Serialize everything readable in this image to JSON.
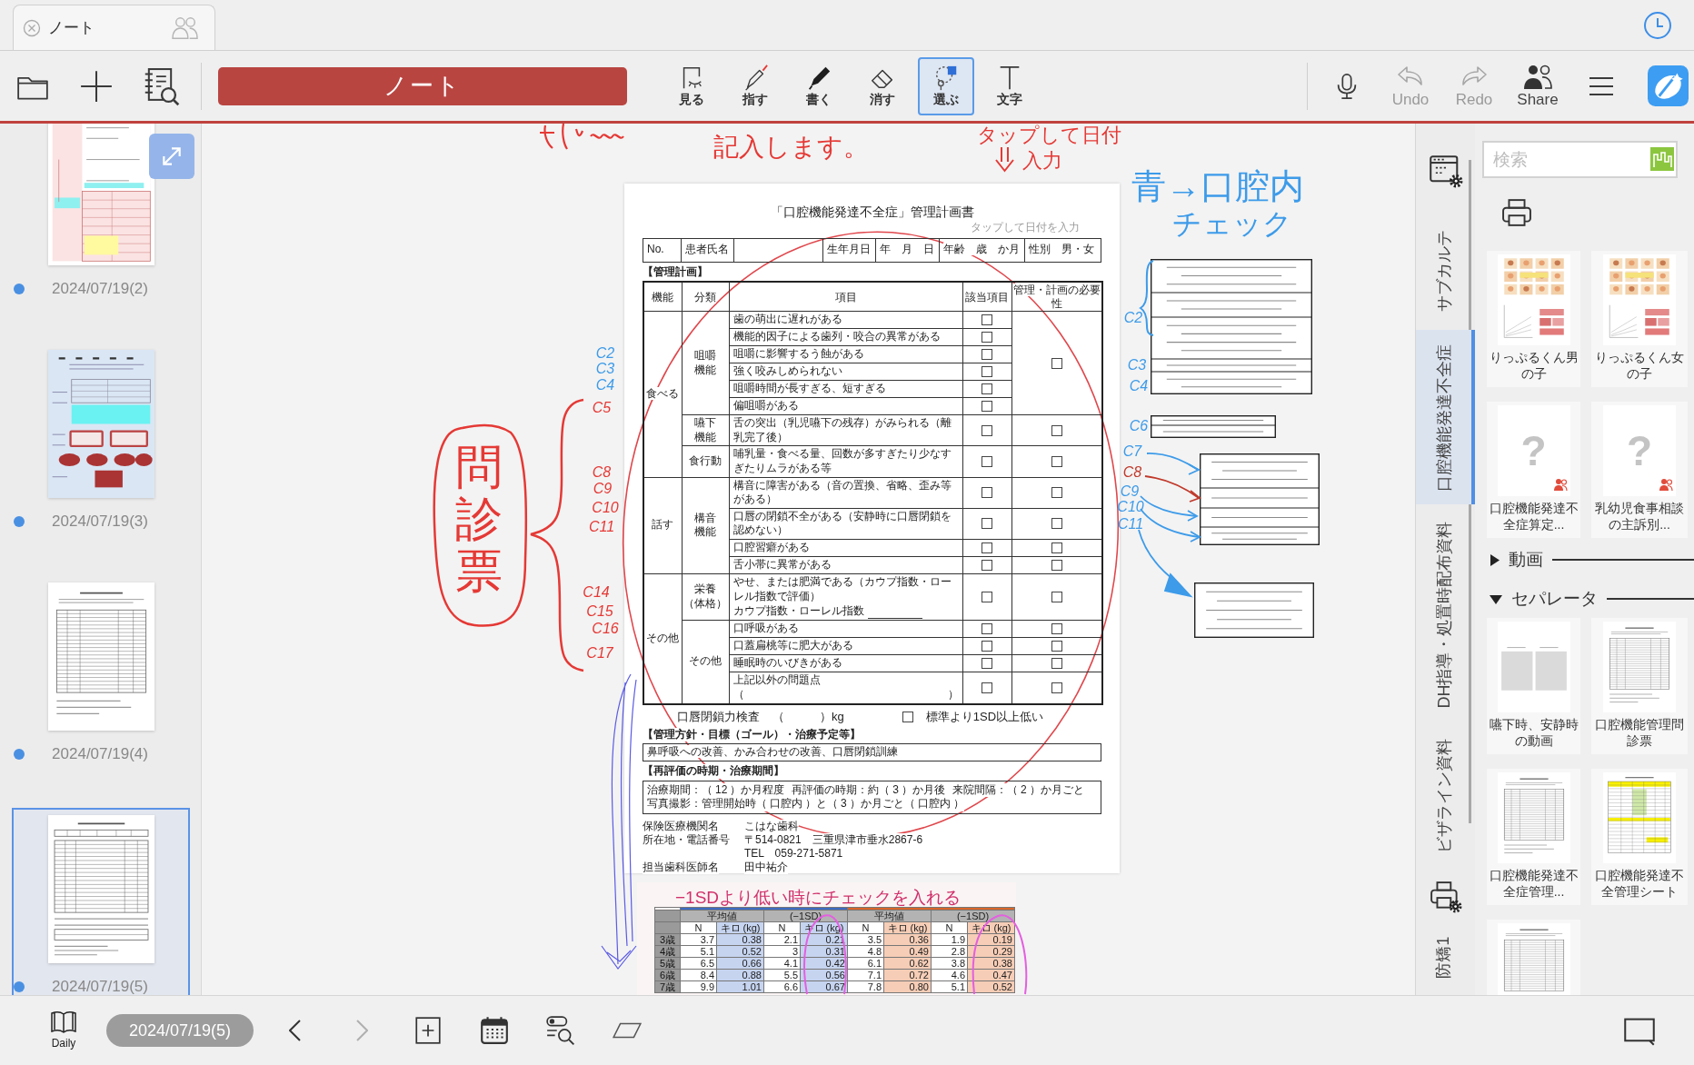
{
  "document_tab": {
    "title": "ノート"
  },
  "toolbar": {
    "title": "ノート",
    "tools": [
      {
        "label": "見る",
        "selected": false
      },
      {
        "label": "指す",
        "selected": false
      },
      {
        "label": "書く",
        "selected": false
      },
      {
        "label": "消す",
        "selected": false
      },
      {
        "label": "選ぶ",
        "selected": true
      },
      {
        "label": "文字",
        "selected": false
      }
    ],
    "actions": [
      {
        "label": "Undo",
        "disabled": true
      },
      {
        "label": "Redo",
        "disabled": true
      },
      {
        "label": "Share",
        "disabled": false
      }
    ]
  },
  "pages": [
    {
      "date": "2024/07/19(2)",
      "kind": "colored-form",
      "selected": false
    },
    {
      "date": "2024/07/19(3)",
      "kind": "photo-sheet",
      "selected": false
    },
    {
      "date": "2024/07/19(4)",
      "kind": "table-sheet",
      "selected": false
    },
    {
      "date": "2024/07/19(5)",
      "kind": "plan-sheet",
      "selected": true
    }
  ],
  "document": {
    "title": "「口腔機能発達不全症」管理計画書",
    "date_hint": "タップして日付を入力",
    "patient_cells": [
      {
        "kind": "text",
        "text": "No."
      },
      {
        "kind": "text",
        "text": "患者氏名"
      },
      {
        "kind": "blank"
      },
      {
        "kind": "text",
        "text": "生年月日"
      },
      {
        "kind": "text",
        "text": "年　月　日"
      },
      {
        "kind": "text",
        "text": "年齢　歳　か月"
      },
      {
        "kind": "text",
        "text": "性別　男・女"
      }
    ],
    "plan_heading": "【管理計画】",
    "columns": [
      "機能",
      "分類",
      "項目",
      "該当項目",
      "管理・計画の必要性"
    ],
    "groups": [
      {
        "function": "食べる",
        "categories": [
          {
            "name_lines": [
              "咀嚼",
              "機能"
            ],
            "need_checked": false,
            "items": [
              {
                "text": "歯の萌出に遅れがある",
                "checked": false
              },
              {
                "text": "機能的因子による歯列・咬合の異常がある",
                "checked": false
              },
              {
                "text": "咀嚼に影響するう蝕がある",
                "checked": false
              },
              {
                "text": "強く咬みしめられない",
                "checked": false
              },
              {
                "text": "咀嚼時間が長すぎる、短すぎる",
                "checked": false
              },
              {
                "text": "偏咀嚼がある",
                "checked": false
              }
            ]
          },
          {
            "name_lines": [
              "嚥下",
              "機能"
            ],
            "items": [
              {
                "text": "舌の突出（乳児嚥下の残存）がみられる（離乳完了後）",
                "checked": false,
                "need_checked": false
              }
            ]
          },
          {
            "name_lines": [
              "食行動"
            ],
            "items": [
              {
                "text": "哺乳量・食べる量、回数が多すぎたり少なすぎたりムラがある等",
                "checked": false,
                "need_checked": false
              }
            ]
          }
        ]
      },
      {
        "function": "話す",
        "categories": [
          {
            "name_lines": [
              "構音",
              "機能"
            ],
            "items": [
              {
                "text": "構音に障害がある（音の置換、省略、歪み等がある）",
                "checked": false,
                "need_checked": false
              },
              {
                "text": "口唇の閉鎖不全がある（安静時に口唇閉鎖を認めない）",
                "checked": false,
                "need_checked": false
              },
              {
                "text": "口腔習癖がある",
                "checked": false,
                "need_checked": false
              },
              {
                "text": "舌小帯に異常がある",
                "checked": false,
                "need_checked": false
              }
            ]
          }
        ]
      },
      {
        "function": "その他",
        "categories": [
          {
            "name_lines": [
              "栄養",
              "（体格）"
            ],
            "items": [
              {
                "text": "やせ、または肥満である（カウプ指数・ローレル指数で評価）",
                "note": "カウプ指数・ローレル指数",
                "checked": false,
                "need_checked": false
              }
            ]
          },
          {
            "name_lines": [
              "その他"
            ],
            "items": [
              {
                "text": "口呼吸がある",
                "checked": false,
                "need_checked": false
              },
              {
                "text": "口蓋扁桃等に肥大がある",
                "checked": false,
                "need_checked": false
              },
              {
                "text": "睡眠時のいびきがある",
                "checked": false,
                "need_checked": false
              },
              {
                "text": "上記以外の問題点",
                "open": "（",
                "close": "）",
                "checked": false,
                "need_checked": false
              }
            ]
          }
        ]
      }
    ],
    "closure": {
      "label": "口唇閉鎖力検査",
      "unit": "（　　　）kg",
      "checked": false,
      "criterion": "標準より1SD以上低い"
    },
    "policy_heading": "【管理方針・目標（ゴール）・治療予定等】",
    "policy": "鼻呼吸への改善、かみ合わせの改善、口唇閉鎖訓練",
    "review_heading": "【再評価の時期・治療期間】",
    "review_lines": [
      {
        "parts": [
          {
            "kind": "print",
            "text": "治療期間：（"
          },
          {
            "kind": "filled",
            "text": "12"
          },
          {
            "kind": "print",
            "text": "）か月程度"
          },
          {
            "kind": "print",
            "text": "再評価の時期：約（"
          },
          {
            "kind": "filled",
            "text": "3"
          },
          {
            "kind": "print",
            "text": "）か月後"
          },
          {
            "kind": "print",
            "text": "来院間隔：（"
          },
          {
            "kind": "filled",
            "text": "2"
          },
          {
            "kind": "print",
            "text": "）か月ごと"
          }
        ]
      },
      {
        "parts": [
          {
            "kind": "print",
            "text": "写真撮影：管理開始時（"
          },
          {
            "kind": "filled",
            "text": "口腔内"
          },
          {
            "kind": "print",
            "text": "）と（"
          },
          {
            "kind": "filled",
            "text": "3"
          },
          {
            "kind": "print",
            "text": "）か月ごと（"
          },
          {
            "kind": "filled",
            "text": "口腔内"
          },
          {
            "kind": "print",
            "text": "）"
          }
        ]
      }
    ],
    "footer": [
      {
        "label": "保険医療機関名",
        "value": "こはな歯科"
      },
      {
        "label": "所在地・電話番号",
        "value": "〒514-0821　三重県津市垂水2867-6"
      },
      {
        "value": "TEL　059-271-5871"
      },
      {
        "label": "担当歯科医師名",
        "value": "田中祐介"
      }
    ]
  },
  "ink": {
    "labels": [
      {
        "text": "C2",
        "color": "#3d9be9"
      },
      {
        "text": "C3",
        "color": "#3d9be9"
      },
      {
        "text": "C4",
        "color": "#3d9be9"
      },
      {
        "text": "C5",
        "color": "#e53935"
      },
      {
        "text": "C8",
        "color": "#e53935"
      },
      {
        "text": "C9",
        "color": "#e53935"
      },
      {
        "text": "C10",
        "color": "#e53935"
      },
      {
        "text": "C11",
        "color": "#e53935"
      },
      {
        "text": "C14",
        "color": "#e53935"
      },
      {
        "text": "C15",
        "color": "#e53935"
      },
      {
        "text": "C16",
        "color": "#e53935"
      },
      {
        "text": "C17",
        "color": "#e53935"
      },
      {
        "text": "C2",
        "color": "#3d9be9"
      },
      {
        "text": "C3",
        "color": "#3d9be9"
      },
      {
        "text": "C4",
        "color": "#3d9be9"
      },
      {
        "text": "C6",
        "color": "#3d9be9"
      },
      {
        "text": "C7",
        "color": "#3d9be9"
      },
      {
        "text": "C8",
        "color": "#c0392b"
      },
      {
        "text": "C9",
        "color": "#3d9be9"
      },
      {
        "text": "C10",
        "color": "#3d9be9"
      },
      {
        "text": "C11",
        "color": "#3d9be9"
      }
    ],
    "notes": [
      {
        "kind": "line",
        "text": "記入します。",
        "color": "#e53935"
      },
      {
        "kind": "line",
        "text": "タップして日付",
        "color": "#e53935"
      },
      {
        "kind": "line",
        "text": "入力",
        "color": "#e53935"
      },
      {
        "kind": "line",
        "text": "青→口腔内",
        "color": "#3d9be9"
      },
      {
        "kind": "line",
        "text": "チェック",
        "color": "#3d9be9"
      },
      {
        "kind": "vertical",
        "text": "問診票",
        "color": "#e53935"
      },
      {
        "kind": "line",
        "text": "−1SDより低い時にチェックを入れる",
        "color": "#d0306a"
      }
    ]
  },
  "growth_table": {
    "bands": [
      {
        "color": "#3e6cc2"
      },
      {
        "color": "#d9662a"
      }
    ],
    "groups": [
      {
        "title": "平均値",
        "color": "#c6d4f0"
      },
      {
        "title": "(−1SD)",
        "color": "#c6d4f0"
      },
      {
        "title": "平均値",
        "color": "#f6cdb6"
      },
      {
        "title": "(−1SD)",
        "color": "#f6cdb6"
      }
    ],
    "subheaders": [
      "N",
      "キロ (kg)",
      "N",
      "キロ (kg)",
      "N",
      "キロ (kg)",
      "N",
      "キロ (kg)"
    ],
    "rows": [
      {
        "label": "3歳",
        "values": [
          "3.7",
          "0.38",
          "2.1",
          "0.21",
          "3.5",
          "0.36",
          "1.9",
          "0.19"
        ]
      },
      {
        "label": "4歳",
        "values": [
          "5.1",
          "0.52",
          "3",
          "0.31",
          "4.8",
          "0.49",
          "2.8",
          "0.29"
        ]
      },
      {
        "label": "5歳",
        "values": [
          "6.5",
          "0.66",
          "4.1",
          "0.42",
          "6.1",
          "0.62",
          "3.8",
          "0.38"
        ]
      },
      {
        "label": "6歳",
        "values": [
          "8.4",
          "0.88",
          "5.5",
          "0.56",
          "7.1",
          "0.72",
          "4.6",
          "0.47"
        ]
      },
      {
        "label": "7歳",
        "values": [
          "9.9",
          "1.01",
          "6.6",
          "0.67",
          "7.8",
          "0.80",
          "5.1",
          "0.52"
        ]
      }
    ]
  },
  "side_tabs": [
    {
      "label": "サブカルテ",
      "selected": false
    },
    {
      "label": "口腔機能発達不全症",
      "selected": true
    },
    {
      "label": "DH指導・処置時配布資料",
      "selected": false
    },
    {
      "label": "ビザライン資料",
      "selected": false
    },
    {
      "label": "防矯1",
      "selected": false
    }
  ],
  "library": {
    "search_placeholder": "検索",
    "items": [
      {
        "kind": "chart-sheet",
        "caption": "りっぷるくん男の子"
      },
      {
        "kind": "chart-sheet",
        "caption": "りっぷるくん女の子"
      },
      {
        "kind": "missing",
        "mark": "?",
        "caption": "口腔機能発達不全症算定..."
      },
      {
        "kind": "missing",
        "mark": "?",
        "caption": "乳幼児食事相談の主訴別..."
      }
    ],
    "sections": [
      {
        "title": "動画",
        "expanded": false
      },
      {
        "title": "セパレータ",
        "expanded": true,
        "items": [
          {
            "kind": "video-pair",
            "caption": "嚥下時、安静時の動画"
          },
          {
            "kind": "table-sheet",
            "caption": "口腔機能管理問診票"
          },
          {
            "kind": "table-sheet",
            "caption": "口腔機能発達不全症管理..."
          },
          {
            "kind": "highlight-sheet",
            "caption": "口腔機能発達不全管理シート"
          },
          {
            "kind": "table-sheet"
          }
        ]
      }
    ]
  },
  "bottom_bar": {
    "daily": "Daily",
    "date": "2024/07/19(5)",
    "prev_disabled": false,
    "next_disabled": true
  }
}
